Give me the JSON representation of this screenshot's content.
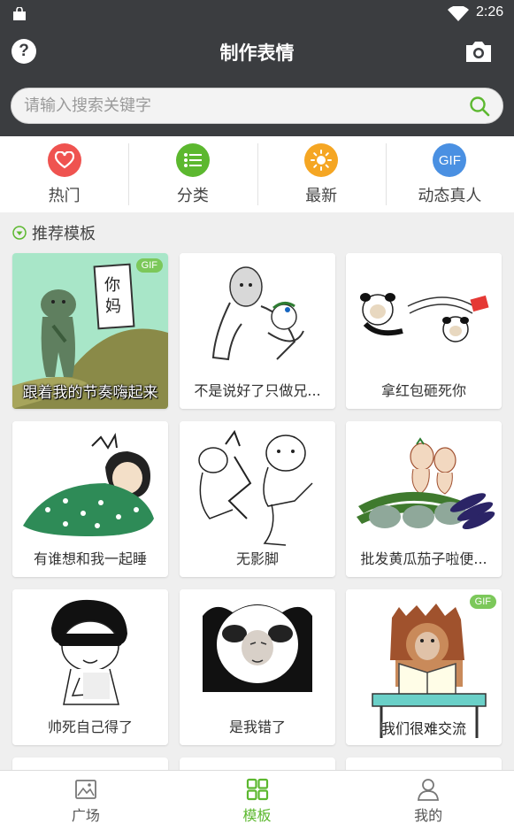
{
  "status": {
    "time": "2:26"
  },
  "appbar": {
    "title": "制作表情",
    "help_glyph": "?"
  },
  "search": {
    "placeholder": "请输入搜索关键字",
    "value": ""
  },
  "categories": [
    {
      "label": "热门",
      "icon": "heart-icon",
      "color": "#ef5350"
    },
    {
      "label": "分类",
      "icon": "list-icon",
      "color": "#5cb82f"
    },
    {
      "label": "最新",
      "icon": "sun-icon",
      "color": "#f5a623"
    },
    {
      "label": "动态真人",
      "icon": "gif-icon",
      "badge": "GIF",
      "color": "#4a90e2"
    }
  ],
  "section": {
    "title": "推荐模板"
  },
  "templates": [
    {
      "caption": "跟着我的节奏嗨起来",
      "gif": "GIF",
      "sign": "你妈"
    },
    {
      "caption": "不是说好了只做兄..."
    },
    {
      "caption": "拿红包砸死你"
    },
    {
      "caption": "有谁想和我一起睡"
    },
    {
      "caption": "无影脚"
    },
    {
      "caption": "批发黄瓜茄子啦便..."
    },
    {
      "caption": "帅死自己得了"
    },
    {
      "caption": "是我错了"
    },
    {
      "caption": "我们很难交流",
      "gif": "GIF"
    }
  ],
  "bottom_nav": [
    {
      "label": "广场",
      "icon": "image-icon",
      "active": false
    },
    {
      "label": "模板",
      "icon": "grid-icon",
      "active": true
    },
    {
      "label": "我的",
      "icon": "user-icon",
      "active": false
    }
  ],
  "colors": {
    "appbar": "#3b3d40",
    "accent": "#5cb82f"
  }
}
